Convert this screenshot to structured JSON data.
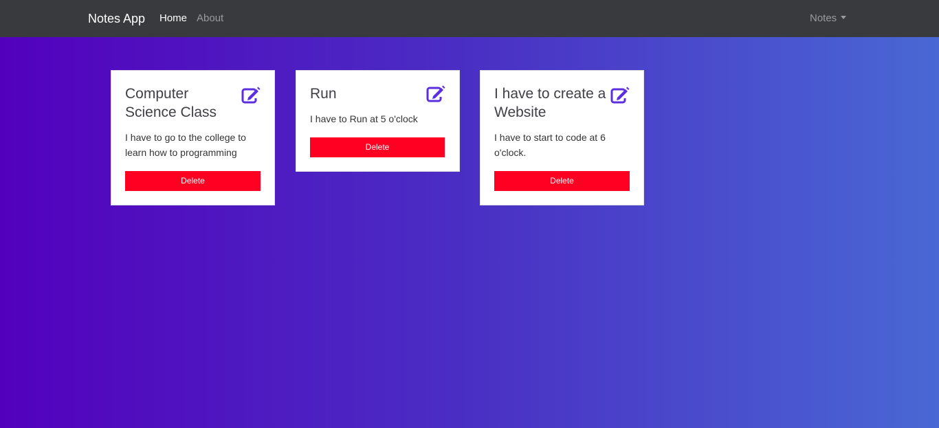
{
  "navbar": {
    "brand": "Notes App",
    "links": [
      "Home",
      "About"
    ],
    "dropdown_label": "Notes"
  },
  "colors": {
    "navbar_bg": "#393a3e",
    "gradient_start": "#5300bd",
    "gradient_end": "#4968d4",
    "accent": "#5b2ee0",
    "delete": "#ff0022"
  },
  "notes": [
    {
      "title": "Computer Science Class",
      "text": "I have to go to the college to learn how to programming",
      "delete_label": "Delete",
      "icon": "edit-icon"
    },
    {
      "title": "Run",
      "text": "I have to Run at 5 o'clock",
      "delete_label": "Delete",
      "icon": "edit-icon"
    },
    {
      "title": "I have to create a Website",
      "text": "I have to start to code at 6 o'clock.",
      "delete_label": "Delete",
      "icon": "edit-icon"
    }
  ]
}
